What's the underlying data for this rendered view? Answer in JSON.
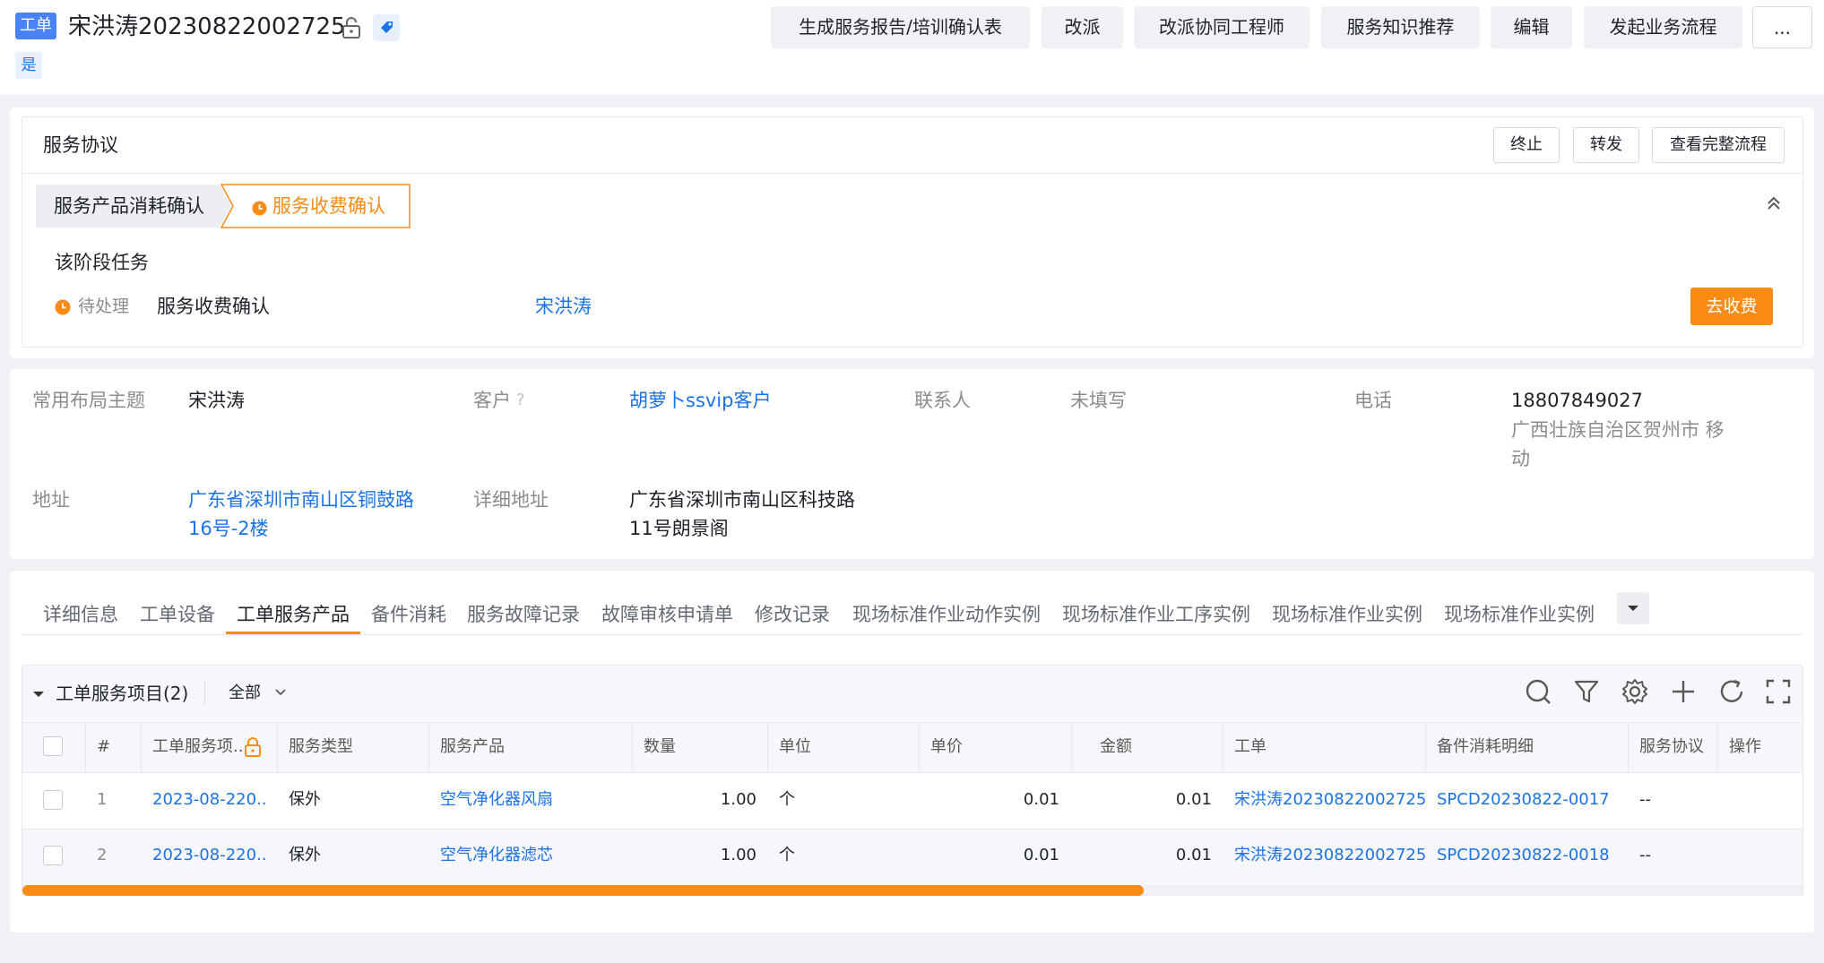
{
  "header": {
    "badge": "工单",
    "title": "宋洪涛20230822002725",
    "yes_badge": "是",
    "buttons": [
      "生成服务报告/培训确认表",
      "改派",
      "改派协同工程师",
      "服务知识推荐",
      "编辑",
      "发起业务流程",
      "..."
    ]
  },
  "agreement": {
    "title": "服务协议",
    "actions": [
      "终止",
      "转发",
      "查看完整流程"
    ],
    "steps": [
      "服务产品消耗确认",
      "服务收费确认"
    ],
    "stage_task_label": "该阶段任务",
    "task": {
      "status": "待处理",
      "name": "服务收费确认",
      "owner": "宋洪涛",
      "action": "去收费"
    }
  },
  "info": {
    "layout_theme_label": "常用布局主题",
    "layout_theme_value": "宋洪涛",
    "customer_label": "客户",
    "customer_value": "胡萝卜ssvip客户",
    "contact_label": "联系人",
    "contact_value": "未填写",
    "phone_label": "电话",
    "phone_value": "18807849027",
    "phone_region_line1": "广西壮族自治区贺州市 移",
    "phone_region_line2": "动",
    "address_label": "地址",
    "address_line1": "广东省深圳市南山区铜鼓路",
    "address_line2": "16号-2楼",
    "detail_address_label": "详细地址",
    "detail_address_line1": "广东省深圳市南山区科技路",
    "detail_address_line2": "11号朗景阁"
  },
  "tabs": [
    "详细信息",
    "工单设备",
    "工单服务产品",
    "备件消耗",
    "服务故障记录",
    "故障审核申请单",
    "修改记录",
    "现场标准作业动作实例",
    "现场标准作业工序实例",
    "现场标准作业实例",
    "现场标准作业实例"
  ],
  "active_tab": "工单服务产品",
  "table": {
    "section_title": "工单服务项目(2)",
    "filter": "全部",
    "headers": [
      "#",
      "工单服务项...",
      "服务类型",
      "服务产品",
      "数量",
      "单位",
      "单价",
      "金额",
      "工单",
      "备件消耗明细",
      "服务协议",
      "操作"
    ],
    "rows": [
      {
        "idx": "1",
        "item": "2023-08-220...",
        "type": "保外",
        "product": "空气净化器风扇",
        "qty": "1.00",
        "unit": "个",
        "price": "0.01",
        "amount": "0.01",
        "order": "宋洪涛20230822002725",
        "spare": "SPCD20230822-0017",
        "agreement": "--"
      },
      {
        "idx": "2",
        "item": "2023-08-220...",
        "type": "保外",
        "product": "空气净化器滤芯",
        "qty": "1.00",
        "unit": "个",
        "price": "0.01",
        "amount": "0.01",
        "order": "宋洪涛20230822002725",
        "spare": "SPCD20230822-0018",
        "agreement": "--"
      }
    ],
    "scroll_progress": 0.63
  },
  "colors": {
    "accent": "#1a73e8",
    "orange": "#fa8c16"
  }
}
